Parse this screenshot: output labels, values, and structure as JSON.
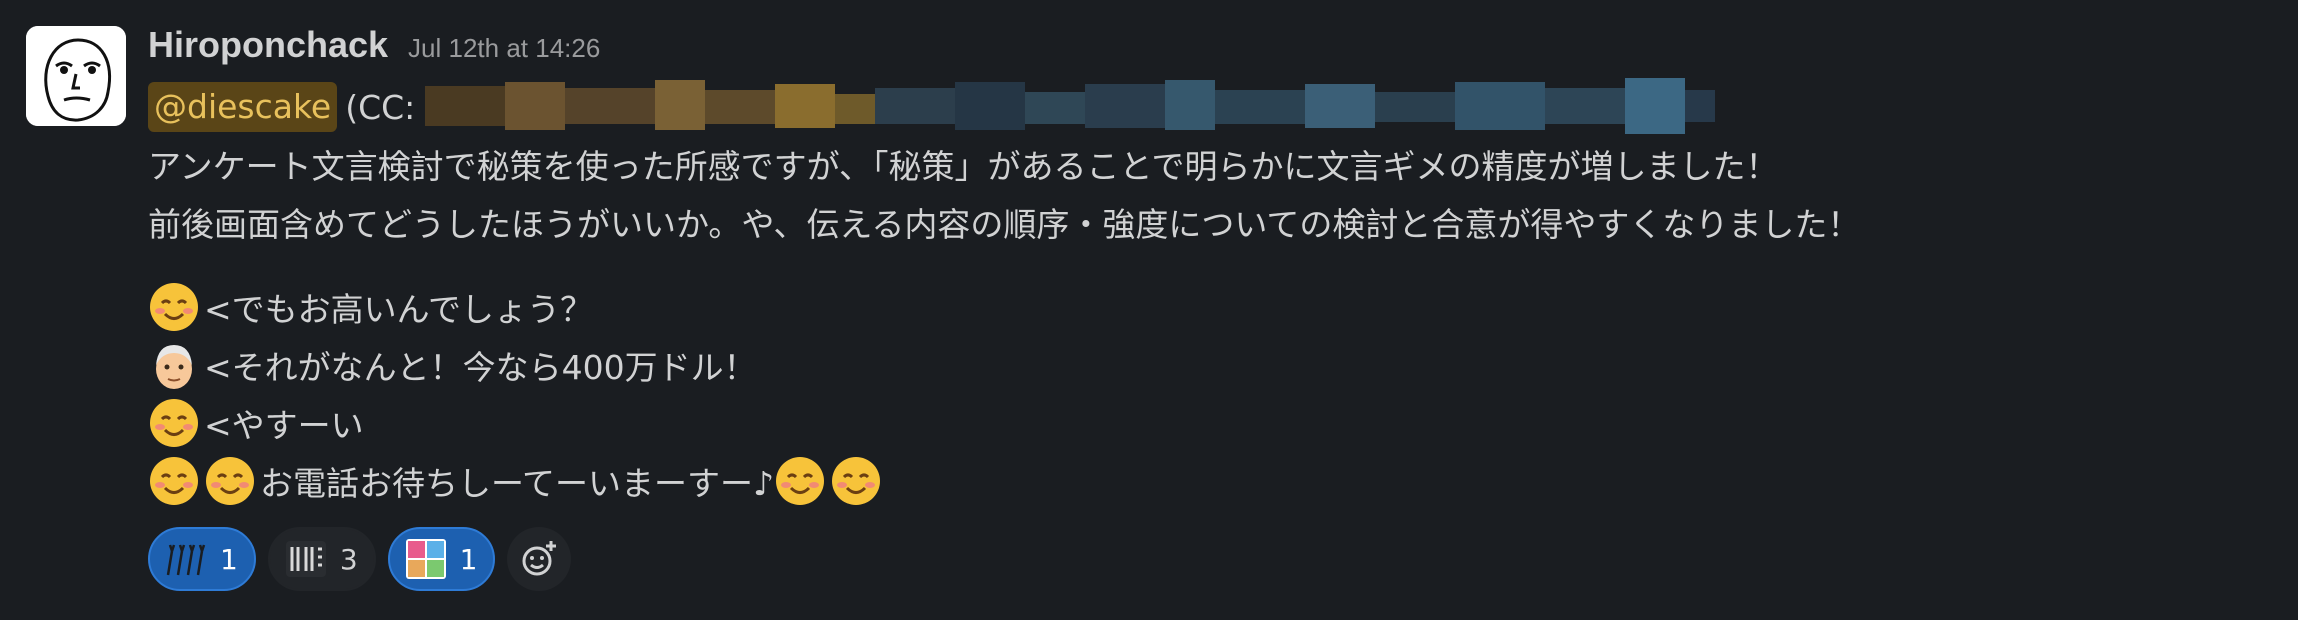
{
  "message": {
    "author": "Hiroponchack",
    "timestamp": "Jul 12th at 14:26",
    "mention": "@diescake",
    "cc_prefix": "(CC:",
    "body_lines": [
      "アンケート文言検討で秘策を使った所感ですが、「秘策」があることで明らかに文言ギメの精度が増しました！",
      "前後画面含めてどうしたほうがいいか。や、伝える内容の順序・強度についての検討と合意が得やすくなりました！"
    ],
    "dialogue": [
      {
        "emoji": [
          "smiling-face-icon"
        ],
        "text": "<でもお高いんでしょう？"
      },
      {
        "emoji": [
          "old-man-icon"
        ],
        "text": "<それがなんと！今なら400万ドル！"
      },
      {
        "emoji": [
          "smiling-face-icon"
        ],
        "text": "<やすーい"
      },
      {
        "emoji": [
          "smiling-face-icon",
          "smiling-face-icon"
        ],
        "text": "お電話お待ちしーてーいまーすー♪",
        "trailing_emoji": [
          "smiling-face-icon",
          "smiling-face-icon"
        ]
      }
    ]
  },
  "reactions": [
    {
      "icon": "hands-icon",
      "count": "1",
      "active": true
    },
    {
      "icon": "ii-sticker-icon",
      "count": "3",
      "active": false
    },
    {
      "icon": "yatta-sticker-icon",
      "count": "1",
      "active": true
    }
  ],
  "colors": {
    "background": "#1a1d21",
    "mention_bg": "#5a4517",
    "mention_text": "#e8c15c",
    "reaction_active": "#1d60b0"
  }
}
